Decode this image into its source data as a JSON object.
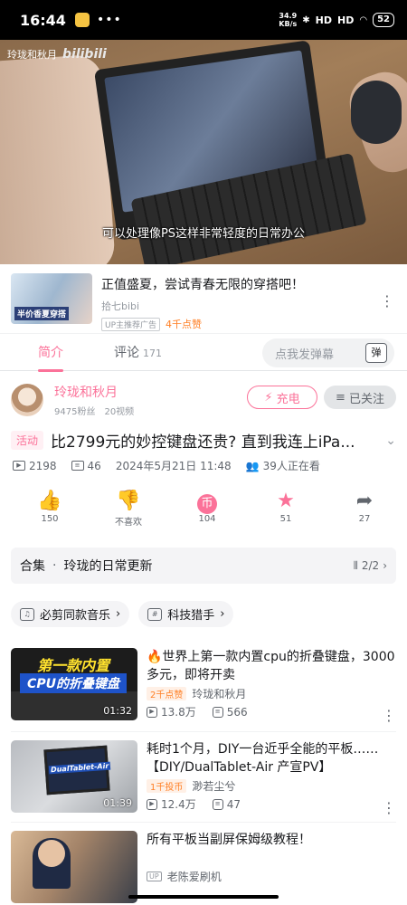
{
  "status_bar": {
    "time": "16:44",
    "net_speed": "34.9",
    "net_unit": "KB/s",
    "signal1": "HD",
    "signal2": "HD",
    "battery": "52"
  },
  "video": {
    "watermark_author": "玲珑和秋月",
    "watermark_logo": "bilibili",
    "subtitle": "可以处理像PS这样非常轻度的日常办公"
  },
  "ad": {
    "thumb_label": "半价香夏穿搭",
    "title": "正值盛夏，尝试青春无限的穿搭吧！",
    "author": "拾七bibi",
    "tag": "UP主推荐广告",
    "count": "4千点赞"
  },
  "tabs": {
    "intro": "简介",
    "comments": "评论",
    "comments_count": "171",
    "danmu_placeholder": "点我发弹幕",
    "danmu_icon": "弹"
  },
  "uploader": {
    "name": "玲珑和秋月",
    "fans": "9475粉丝",
    "videos": "20视频",
    "charge_label": "充电",
    "follow_label": "已关注"
  },
  "video_info": {
    "activity_tag": "活动",
    "title": "比2799元的妙控键盘还贵? 直到我连上iPa...",
    "views": "2198",
    "danmaku": "46",
    "date": "2024年5月21日 11:48",
    "watching": "39人正在看"
  },
  "actions": [
    {
      "name": "like",
      "label": "150"
    },
    {
      "name": "dislike",
      "label": "不喜欢"
    },
    {
      "name": "coin",
      "label": "104"
    },
    {
      "name": "favorite",
      "label": "51"
    },
    {
      "name": "share",
      "label": "27"
    }
  ],
  "collection": {
    "label": "合集",
    "name": "玲珑的日常更新",
    "progress": "2/2"
  },
  "chips": [
    {
      "label": "必剪同款音乐"
    },
    {
      "label": "科技猎手"
    }
  ],
  "recommendations": [
    {
      "thumb_line1": "第一款内置",
      "thumb_line2": "CPU的折叠键盘",
      "duration": "01:32",
      "title": "🔥世界上第一款内置cpu的折叠键盘，3000多元，即将开卖",
      "badge": "2千点赞",
      "author": "玲珑和秋月",
      "views": "13.8万",
      "danmaku": "566"
    },
    {
      "thumb_label": "DualTablet-Air",
      "duration": "01:39",
      "title": "耗时1个月，DIY一台近乎全能的平板……【DIY/DualTablet-Air 产宣PV】",
      "badge": "1千投币",
      "author": "渺若尘兮",
      "views": "12.4万",
      "danmaku": "47"
    },
    {
      "title": "所有平板当副屏保姆级教程！",
      "up_badge": "UP",
      "author": "老陈爱刷机"
    }
  ]
}
